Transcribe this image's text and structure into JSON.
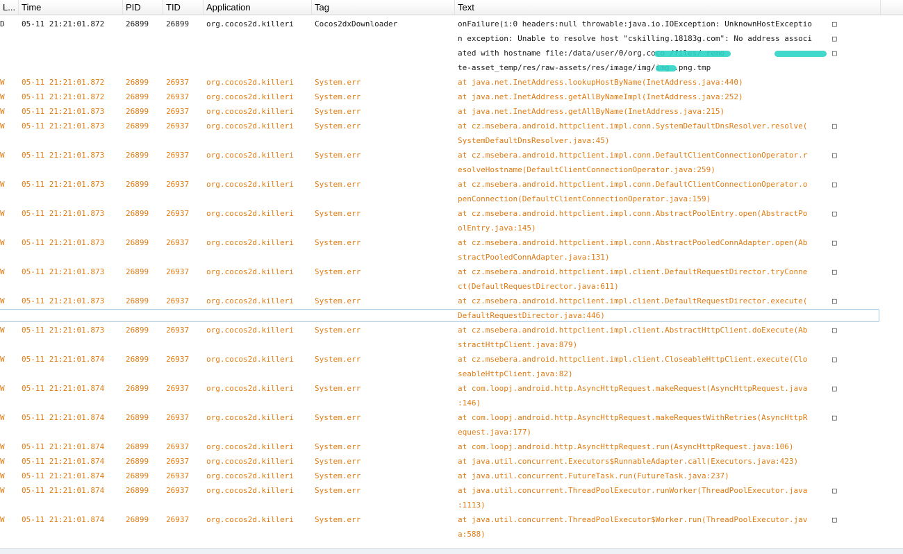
{
  "columns": {
    "level": "L...",
    "time": "Time",
    "pid": "PID",
    "tid": "TID",
    "app": "Application",
    "tag": "Tag",
    "text": "Text"
  },
  "overflow_glyph": "□",
  "colors": {
    "debug": "#1a1a1a",
    "warning": "#e07b12",
    "selection_border": "#a9c8e4",
    "redaction": "#2ed4c7"
  },
  "rows": [
    {
      "level": "D",
      "time": "05-11 21:21:01.872",
      "pid": "26899",
      "tid": "26899",
      "app": "org.cocos2d.killeri",
      "tag": "Cocos2dxDownloader",
      "text": [
        "onFailure(i:0 headers:null throwable:java.io.IOException: UnknownHostExceptio",
        "n exception: Unable to resolve host \"cskilling.18183g.com\": No address associ",
        "ated with hostname file:/data/user/0/org.coco          /files/          remo",
        "te-asset_temp/res/raw-assets/res/image/img/img   .png.tmp"
      ]
    },
    {
      "level": "W",
      "time": "05-11 21:21:01.872",
      "pid": "26899",
      "tid": "26937",
      "app": "org.cocos2d.killeri",
      "tag": "System.err",
      "text": [
        "at java.net.InetAddress.lookupHostByName(InetAddress.java:440)"
      ]
    },
    {
      "level": "W",
      "time": "05-11 21:21:01.872",
      "pid": "26899",
      "tid": "26937",
      "app": "org.cocos2d.killeri",
      "tag": "System.err",
      "text": [
        "at java.net.InetAddress.getAllByNameImpl(InetAddress.java:252)"
      ]
    },
    {
      "level": "W",
      "time": "05-11 21:21:01.873",
      "pid": "26899",
      "tid": "26937",
      "app": "org.cocos2d.killeri",
      "tag": "System.err",
      "text": [
        "at java.net.InetAddress.getAllByName(InetAddress.java:215)"
      ]
    },
    {
      "level": "W",
      "time": "05-11 21:21:01.873",
      "pid": "26899",
      "tid": "26937",
      "app": "org.cocos2d.killeri",
      "tag": "System.err",
      "text": [
        "at cz.msebera.android.httpclient.impl.conn.SystemDefaultDnsResolver.resolve(",
        "SystemDefaultDnsResolver.java:45)"
      ]
    },
    {
      "level": "W",
      "time": "05-11 21:21:01.873",
      "pid": "26899",
      "tid": "26937",
      "app": "org.cocos2d.killeri",
      "tag": "System.err",
      "text": [
        "at cz.msebera.android.httpclient.impl.conn.DefaultClientConnectionOperator.r",
        "esolveHostname(DefaultClientConnectionOperator.java:259)"
      ]
    },
    {
      "level": "W",
      "time": "05-11 21:21:01.873",
      "pid": "26899",
      "tid": "26937",
      "app": "org.cocos2d.killeri",
      "tag": "System.err",
      "text": [
        "at cz.msebera.android.httpclient.impl.conn.DefaultClientConnectionOperator.o",
        "penConnection(DefaultClientConnectionOperator.java:159)"
      ]
    },
    {
      "level": "W",
      "time": "05-11 21:21:01.873",
      "pid": "26899",
      "tid": "26937",
      "app": "org.cocos2d.killeri",
      "tag": "System.err",
      "text": [
        "at cz.msebera.android.httpclient.impl.conn.AbstractPoolEntry.open(AbstractPo",
        "olEntry.java:145)"
      ]
    },
    {
      "level": "W",
      "time": "05-11 21:21:01.873",
      "pid": "26899",
      "tid": "26937",
      "app": "org.cocos2d.killeri",
      "tag": "System.err",
      "text": [
        "at cz.msebera.android.httpclient.impl.conn.AbstractPooledConnAdapter.open(Ab",
        "stractPooledConnAdapter.java:131)"
      ]
    },
    {
      "level": "W",
      "time": "05-11 21:21:01.873",
      "pid": "26899",
      "tid": "26937",
      "app": "org.cocos2d.killeri",
      "tag": "System.err",
      "text": [
        "at cz.msebera.android.httpclient.impl.client.DefaultRequestDirector.tryConne",
        "ct(DefaultRequestDirector.java:611)"
      ]
    },
    {
      "level": "W",
      "time": "05-11 21:21:01.873",
      "pid": "26899",
      "tid": "26937",
      "app": "org.cocos2d.killeri",
      "tag": "System.err",
      "selected": true,
      "text": [
        "at cz.msebera.android.httpclient.impl.client.DefaultRequestDirector.execute(",
        "DefaultRequestDirector.java:446)"
      ]
    },
    {
      "level": "W",
      "time": "05-11 21:21:01.873",
      "pid": "26899",
      "tid": "26937",
      "app": "org.cocos2d.killeri",
      "tag": "System.err",
      "text": [
        "at cz.msebera.android.httpclient.impl.client.AbstractHttpClient.doExecute(Ab",
        "stractHttpClient.java:879)"
      ]
    },
    {
      "level": "W",
      "time": "05-11 21:21:01.874",
      "pid": "26899",
      "tid": "26937",
      "app": "org.cocos2d.killeri",
      "tag": "System.err",
      "text": [
        "at cz.msebera.android.httpclient.impl.client.CloseableHttpClient.execute(Clo",
        "seableHttpClient.java:82)"
      ]
    },
    {
      "level": "W",
      "time": "05-11 21:21:01.874",
      "pid": "26899",
      "tid": "26937",
      "app": "org.cocos2d.killeri",
      "tag": "System.err",
      "text": [
        "at com.loopj.android.http.AsyncHttpRequest.makeRequest(AsyncHttpRequest.java",
        ":146)"
      ]
    },
    {
      "level": "W",
      "time": "05-11 21:21:01.874",
      "pid": "26899",
      "tid": "26937",
      "app": "org.cocos2d.killeri",
      "tag": "System.err",
      "text": [
        "at com.loopj.android.http.AsyncHttpRequest.makeRequestWithRetries(AsyncHttpR",
        "equest.java:177)"
      ]
    },
    {
      "level": "W",
      "time": "05-11 21:21:01.874",
      "pid": "26899",
      "tid": "26937",
      "app": "org.cocos2d.killeri",
      "tag": "System.err",
      "text": [
        "at com.loopj.android.http.AsyncHttpRequest.run(AsyncHttpRequest.java:106)"
      ]
    },
    {
      "level": "W",
      "time": "05-11 21:21:01.874",
      "pid": "26899",
      "tid": "26937",
      "app": "org.cocos2d.killeri",
      "tag": "System.err",
      "text": [
        "at java.util.concurrent.Executors$RunnableAdapter.call(Executors.java:423)"
      ]
    },
    {
      "level": "W",
      "time": "05-11 21:21:01.874",
      "pid": "26899",
      "tid": "26937",
      "app": "org.cocos2d.killeri",
      "tag": "System.err",
      "text": [
        "at java.util.concurrent.FutureTask.run(FutureTask.java:237)"
      ]
    },
    {
      "level": "W",
      "time": "05-11 21:21:01.874",
      "pid": "26899",
      "tid": "26937",
      "app": "org.cocos2d.killeri",
      "tag": "System.err",
      "text": [
        "at java.util.concurrent.ThreadPoolExecutor.runWorker(ThreadPoolExecutor.java",
        ":1113)"
      ]
    },
    {
      "level": "W",
      "time": "05-11 21:21:01.874",
      "pid": "26899",
      "tid": "26937",
      "app": "org.cocos2d.killeri",
      "tag": "System.err",
      "text": [
        "at java.util.concurrent.ThreadPoolExecutor$Worker.run(ThreadPoolExecutor.jav",
        "a:588)"
      ]
    }
  ]
}
